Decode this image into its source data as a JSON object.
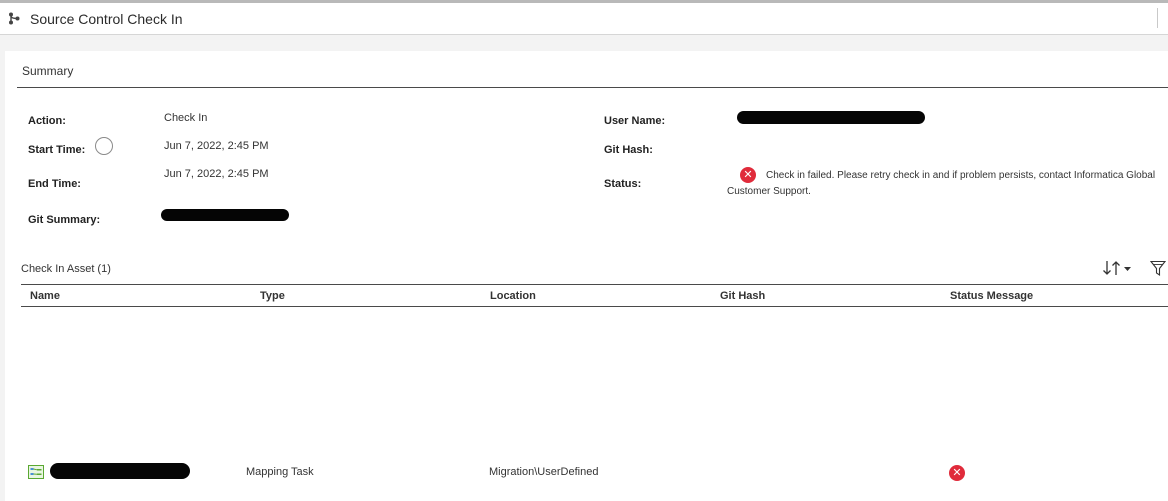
{
  "window": {
    "title": "Source Control Check In"
  },
  "summary": {
    "heading": "Summary",
    "fields": {
      "action_label": "Action:",
      "action_value": "Check In",
      "start_time_label": "Start Time:",
      "start_time_value": "Jun 7, 2022, 2:45 PM",
      "end_time_label": "End Time:",
      "end_time_value": "Jun 7, 2022, 2:45 PM",
      "git_summary_label": "Git Summary:",
      "user_name_label": "User Name:",
      "git_hash_label": "Git Hash:",
      "status_label": "Status:",
      "status_message": "Check in failed. Please retry check in and if problem persists, contact Informatica Global Customer Support."
    }
  },
  "assets": {
    "heading": "Check In Asset (1)",
    "columns": [
      "Name",
      "Type",
      "Location",
      "Git Hash",
      "Status Message"
    ],
    "rows": [
      {
        "type": "Mapping Task",
        "location": "Migration\\UserDefined",
        "icon": "mapping-task-icon",
        "status_icon": "error-icon"
      }
    ]
  },
  "icons": {
    "title": "source-control-icon",
    "sort": "sort-icon",
    "filter": "filter-icon",
    "status": "error-icon"
  },
  "colors": {
    "error": "#e02b3b",
    "mapping_task_icon": "#5aa832"
  }
}
